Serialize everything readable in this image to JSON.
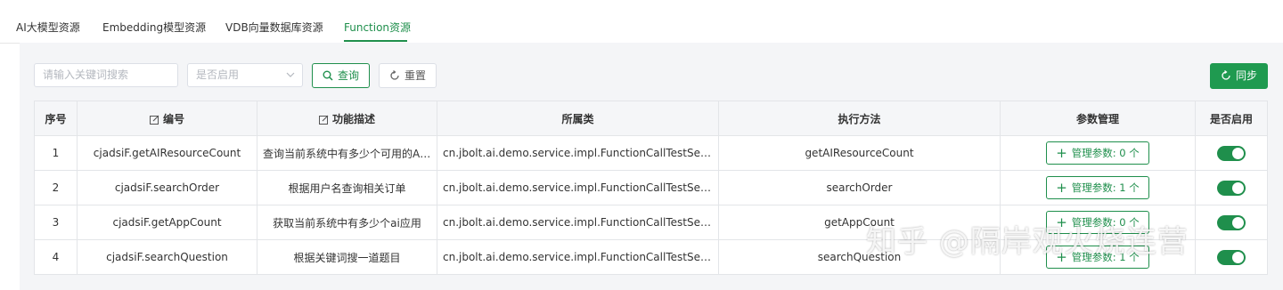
{
  "tabs": [
    "AI大模型资源",
    "Embedding模型资源",
    "VDB向量数据库资源",
    "Function资源"
  ],
  "active_tab": "Function资源",
  "filters": {
    "keyword_placeholder": "请输入关键词搜索",
    "enabled_placeholder": "是否启用",
    "query_label": "查询",
    "reset_label": "重置",
    "sync_label": "同步"
  },
  "table": {
    "headers": [
      "序号",
      "编号",
      "功能描述",
      "所属类",
      "执行方法",
      "参数管理",
      "是否启用"
    ],
    "rows": [
      {
        "idx": "1",
        "code": "cjadsiF.getAIResourceCount",
        "desc": "查询当前系统中有多少个可用的AI...",
        "cls": "cn.jbolt.ai.demo.service.impl.FunctionCallTestService",
        "method": "getAIResourceCount",
        "params": "管理参数: 0 个",
        "enabled": true
      },
      {
        "idx": "2",
        "code": "cjadsiF.searchOrder",
        "desc": "根据用户名查询相关订单",
        "cls": "cn.jbolt.ai.demo.service.impl.FunctionCallTestService",
        "method": "searchOrder",
        "params": "管理参数: 1 个",
        "enabled": true
      },
      {
        "idx": "3",
        "code": "cjadsiF.getAppCount",
        "desc": "获取当前系统中有多少个ai应用",
        "cls": "cn.jbolt.ai.demo.service.impl.FunctionCallTestService",
        "method": "getAppCount",
        "params": "管理参数: 0 个",
        "enabled": true
      },
      {
        "idx": "4",
        "code": "cjadsiF.searchQuestion",
        "desc": "根据关键词搜一道题目",
        "cls": "cn.jbolt.ai.demo.service.impl.FunctionCallTestService",
        "method": "searchQuestion",
        "params": "管理参数: 1 个",
        "enabled": true
      }
    ]
  },
  "watermark": "知乎 @隔岸观火烧连营",
  "colors": {
    "accent": "#1f8f4c",
    "sync_bg": "#1f9a50"
  }
}
